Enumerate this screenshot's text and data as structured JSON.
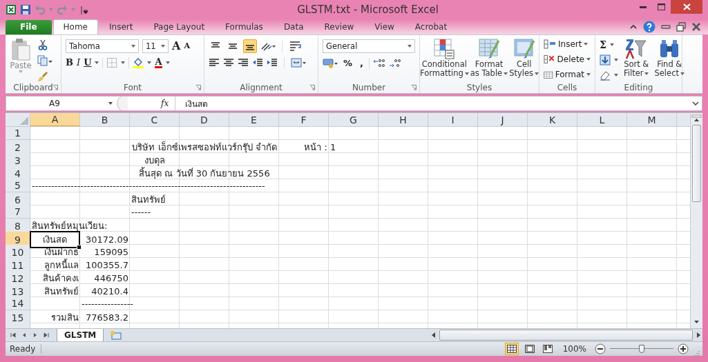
{
  "window": {
    "title": "GLSTM.txt - Microsoft Excel"
  },
  "tabs": [
    {
      "label": "File",
      "kind": "file",
      "selected": false
    },
    {
      "label": "Home",
      "kind": "tab",
      "selected": true
    },
    {
      "label": "Insert",
      "kind": "tab",
      "selected": false
    },
    {
      "label": "Page Layout",
      "kind": "tab",
      "selected": false
    },
    {
      "label": "Formulas",
      "kind": "tab",
      "selected": false
    },
    {
      "label": "Data",
      "kind": "tab",
      "selected": false
    },
    {
      "label": "Review",
      "kind": "tab",
      "selected": false
    },
    {
      "label": "View",
      "kind": "tab",
      "selected": false
    },
    {
      "label": "Acrobat",
      "kind": "tab",
      "selected": false
    }
  ],
  "ribbon": {
    "clipboard": {
      "title": "Clipboard",
      "paste": "Paste"
    },
    "font": {
      "title": "Font",
      "name": "Tahoma",
      "size": "11",
      "grow_font": "A",
      "shrink_font": "A",
      "bold": "B",
      "italic": "I",
      "underline": "U",
      "font_color_button": "A"
    },
    "alignment": {
      "title": "Alignment",
      "vertical": [
        {
          "selected": false
        },
        {
          "selected": false
        },
        {
          "selected": true
        }
      ]
    },
    "number": {
      "title": "Number",
      "format": "General",
      "percent": "%",
      "comma": ","
    },
    "styles": {
      "title": "Styles",
      "buttons": [
        [
          "Conditional",
          "Formatting"
        ],
        [
          "Format",
          "as Table"
        ],
        [
          "Cell",
          "Styles"
        ]
      ]
    },
    "cells": {
      "title": "Cells",
      "buttons": [
        "Insert",
        "Delete",
        "Format"
      ]
    },
    "editing": {
      "title": "Editing",
      "sum": "Σ",
      "buttons": [
        [
          "Sort &",
          "Filter"
        ],
        [
          "Find &",
          "Select"
        ]
      ]
    }
  },
  "formula_bar": {
    "name_box": "A9",
    "fx": "fx",
    "value": "เงินสด"
  },
  "sheet": {
    "columns": [
      {
        "label": "A",
        "selected": true
      },
      {
        "label": "B",
        "selected": false
      },
      {
        "label": "C",
        "selected": false
      },
      {
        "label": "D",
        "selected": false
      },
      {
        "label": "E",
        "selected": false
      },
      {
        "label": "F",
        "selected": false
      },
      {
        "label": "G",
        "selected": false
      },
      {
        "label": "H",
        "selected": false
      },
      {
        "label": "I",
        "selected": false
      },
      {
        "label": "J",
        "selected": false
      },
      {
        "label": "K",
        "selected": false
      },
      {
        "label": "L",
        "selected": false
      },
      {
        "label": "M",
        "selected": false
      }
    ],
    "rows": [
      {
        "number": "1",
        "selected": false,
        "cells": []
      },
      {
        "number": "2",
        "selected": false,
        "cells": [
          "",
          "",
          "",
          {
            "text": "บริษัท เอ็กซ์เพรสซอฟท์แวร์กรุ๊ป จำกัด",
            "kind": "title",
            "selected": false
          },
          "",
          {
            "text": "หน้า :",
            "kind": "number",
            "selected": false
          },
          {
            "text": "1",
            "kind": "text",
            "selected": false
          }
        ]
      },
      {
        "number": "3",
        "selected": false,
        "cells": [
          "",
          "",
          {
            "text": "งบดุล",
            "kind": "title",
            "selected": false
          }
        ]
      },
      {
        "number": "4",
        "selected": false,
        "cells": [
          "",
          "",
          "",
          {
            "text": "สิ้นสุด ณ วันที่ 30 กันยายน 2556",
            "kind": "title",
            "selected": false
          }
        ]
      },
      {
        "number": "5",
        "selected": false,
        "cells": [
          {
            "text": "------------------------------------------------------------------------",
            "kind": "text",
            "selected": false
          }
        ]
      },
      {
        "number": "6",
        "selected": false,
        "cells": [
          "",
          "",
          {
            "text": "สินทรัพย์",
            "kind": "text",
            "selected": false
          }
        ]
      },
      {
        "number": "7",
        "selected": false,
        "cells": [
          "",
          "",
          {
            "text": "------",
            "kind": "text",
            "selected": false
          }
        ]
      },
      {
        "number": "8",
        "selected": false,
        "cells": [
          {
            "text": "สินทรัพย์หมุนเวียน:",
            "kind": "text",
            "selected": false
          }
        ]
      },
      {
        "number": "9",
        "selected": true,
        "cells": [
          {
            "text": "เงินสด",
            "kind": "title",
            "selected": true
          },
          {
            "text": "30172.09",
            "kind": "number",
            "selected": false
          }
        ]
      },
      {
        "number": "10",
        "selected": false,
        "cells": [
          {
            "text": "เงินฝากธ",
            "kind": "number",
            "selected": false
          },
          {
            "text": "159095",
            "kind": "number",
            "selected": false
          }
        ]
      },
      {
        "number": "11",
        "selected": false,
        "cells": [
          {
            "text": "ลูกหนี้แล",
            "kind": "number",
            "selected": false
          },
          {
            "text": "100355.7",
            "kind": "number",
            "selected": false
          }
        ]
      },
      {
        "number": "12",
        "selected": false,
        "cells": [
          {
            "text": "สินค้าคงเ",
            "kind": "number",
            "selected": false
          },
          {
            "text": "446750",
            "kind": "number",
            "selected": false
          }
        ]
      },
      {
        "number": "13",
        "selected": false,
        "cells": [
          {
            "text": "สินทรัพย์",
            "kind": "number",
            "selected": false
          },
          {
            "text": "40210.4",
            "kind": "number",
            "selected": false
          }
        ]
      },
      {
        "number": "14",
        "selected": false,
        "cells": [
          "",
          {
            "text": "----------------",
            "kind": "text",
            "selected": false
          }
        ]
      },
      {
        "number": "15",
        "selected": false,
        "cells": [
          {
            "text": "รวมสิน",
            "kind": "number",
            "selected": false
          },
          {
            "text": "776583.2",
            "kind": "number",
            "selected": false
          }
        ]
      }
    ]
  },
  "sheet_tabs": [
    {
      "label": "GLSTM",
      "selected": true
    }
  ],
  "status_bar": {
    "status": "Ready",
    "views": [
      {
        "selected": true
      },
      {
        "selected": false
      },
      {
        "selected": false
      }
    ],
    "zoom": "100%",
    "zoom_slider": {
      "level": 0.5
    }
  }
}
